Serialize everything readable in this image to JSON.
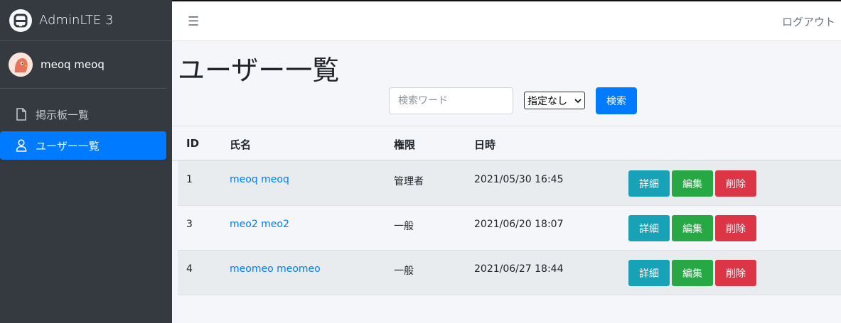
{
  "brand": {
    "name": "AdminLTE 3"
  },
  "user": {
    "name": "meoq meoq"
  },
  "nav": [
    {
      "label": "掲示板一覧",
      "icon": "file-icon",
      "active": false
    },
    {
      "label": "ユーザー一覧",
      "icon": "user-icon",
      "active": true
    }
  ],
  "topbar": {
    "logout": "ログアウト"
  },
  "page": {
    "title": "ユーザー一覧"
  },
  "search": {
    "placeholder": "検索ワード",
    "select_value": "指定なし",
    "button": "検索"
  },
  "table": {
    "headers": [
      "ID",
      "氏名",
      "権限",
      "日時"
    ],
    "rows": [
      {
        "id": "1",
        "name": "meoq meoq",
        "role": "管理者",
        "date": "2021/05/30 16:45"
      },
      {
        "id": "3",
        "name": "meo2 meo2",
        "role": "一般",
        "date": "2021/06/20 18:07"
      },
      {
        "id": "4",
        "name": "meomeo meomeo",
        "role": "一般",
        "date": "2021/06/27 18:44"
      }
    ],
    "actions": {
      "detail": "詳細",
      "edit": "編集",
      "delete": "削除"
    }
  },
  "colors": {
    "sidebar": "#343a40",
    "primary": "#007bff",
    "info": "#17a2b8",
    "success": "#28a745",
    "danger": "#dc3545"
  }
}
